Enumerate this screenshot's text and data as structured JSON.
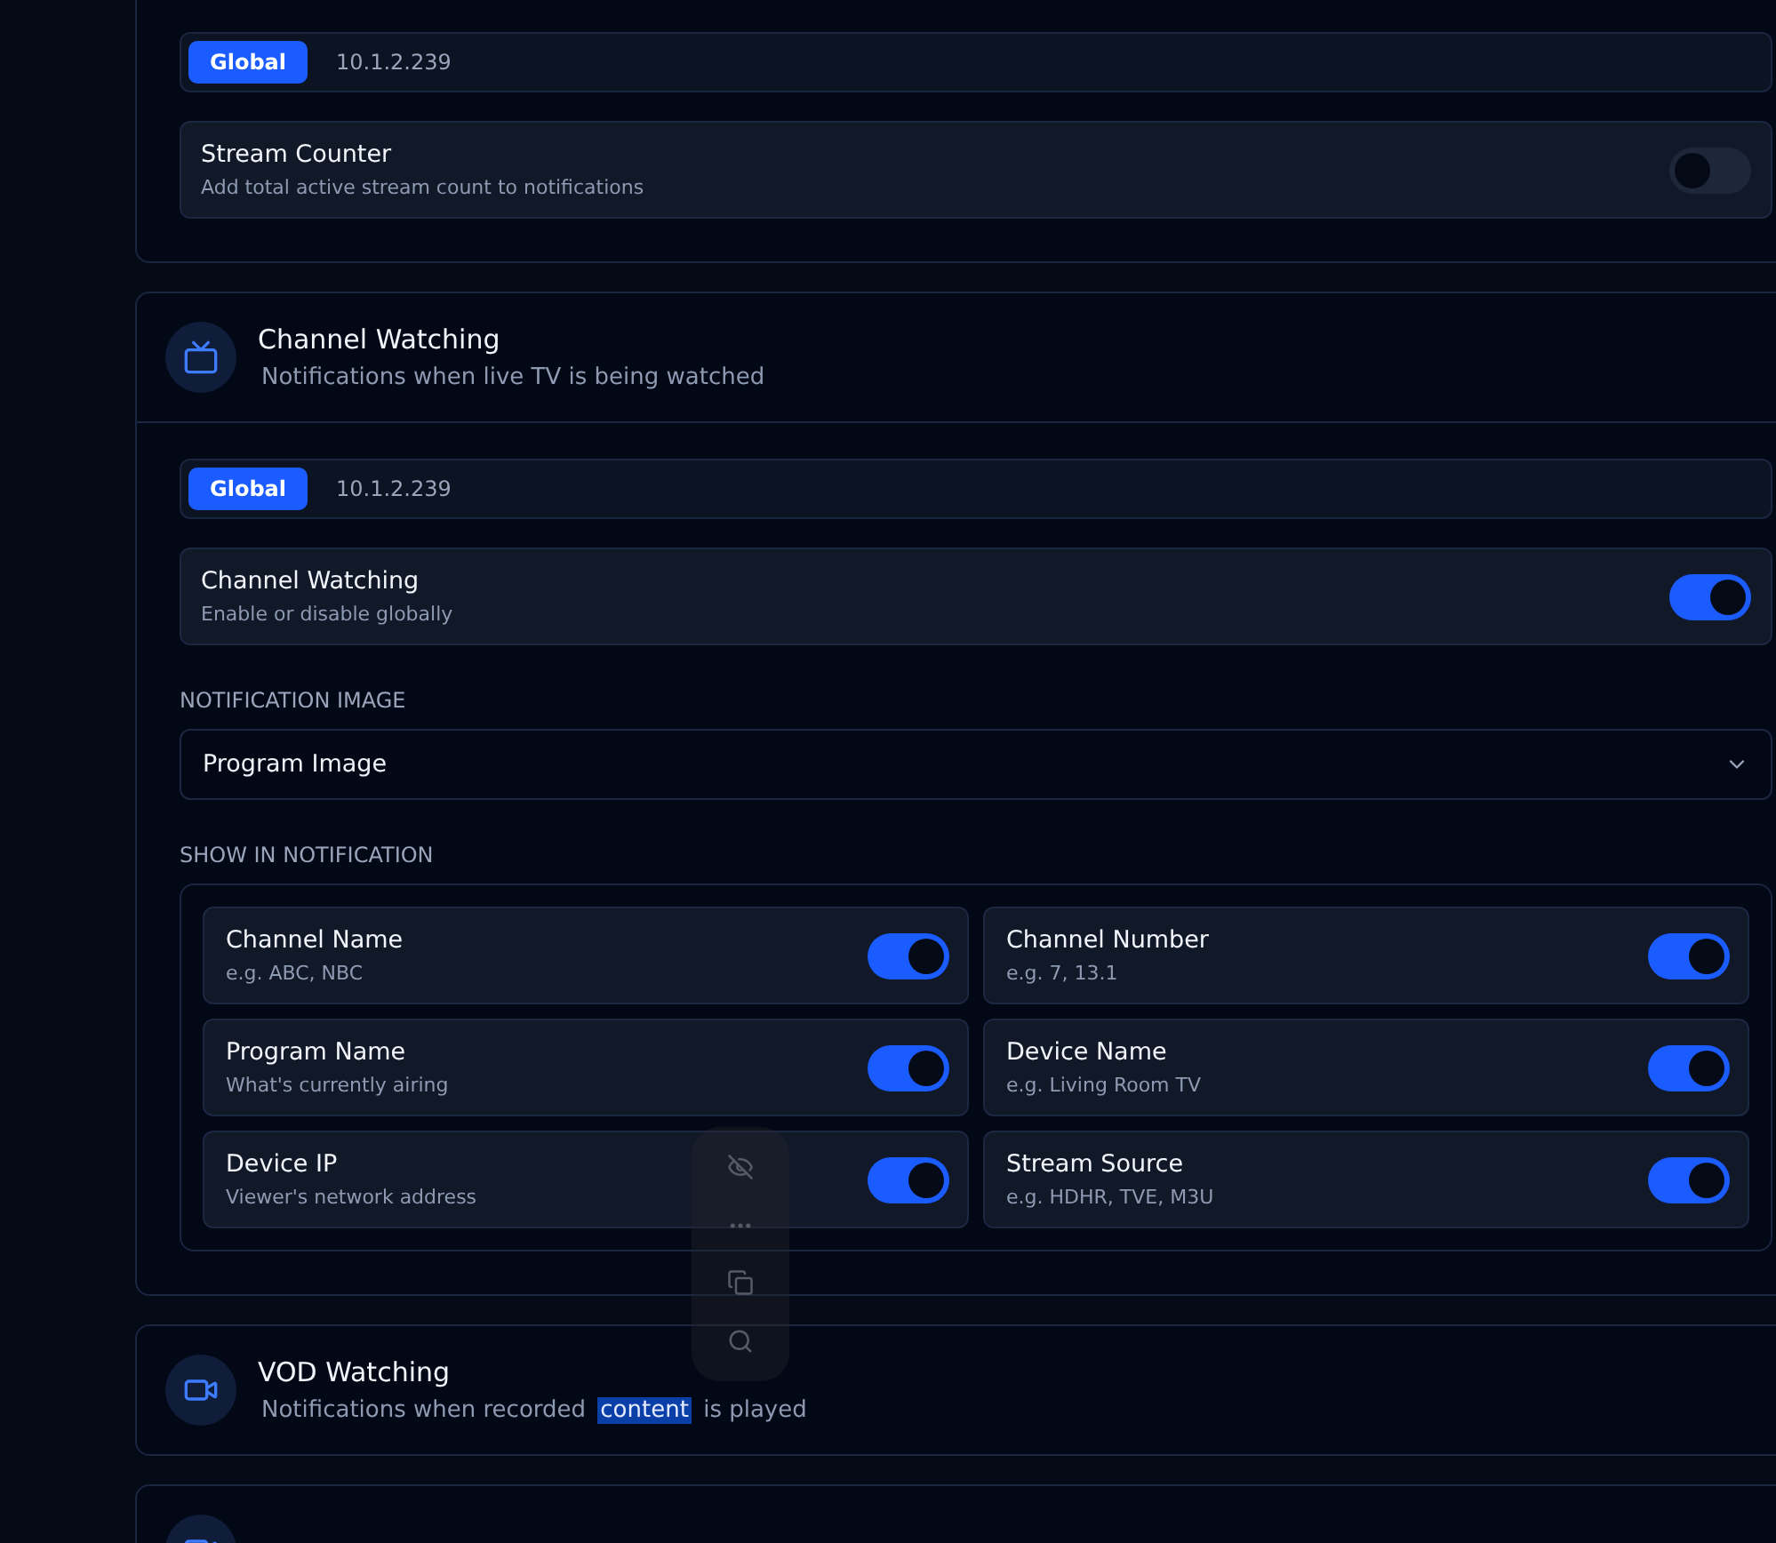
{
  "sections": [
    {
      "kind": "partial",
      "scope": {
        "badge": "Global",
        "ip": "10.1.2.239"
      },
      "setting": {
        "title": "Stream Counter",
        "description": "Add total active stream count to notifications",
        "on": false
      }
    },
    {
      "kind": "expanded",
      "title": "Channel Watching",
      "subtitle": [
        {
          "text": "Notifications when live TV is being watched",
          "selected": false
        }
      ],
      "scope": {
        "badge": "Global",
        "ip": "10.1.2.239"
      },
      "setting": {
        "title": "Channel Watching",
        "description": "Enable or disable globally",
        "on": true
      },
      "image_label": "NOTIFICATION IMAGE",
      "image_value": "Program Image",
      "show_label": "SHOW IN NOTIFICATION",
      "fields": [
        {
          "title": "Channel Name",
          "description": "e.g. ABC, NBC",
          "on": true
        },
        {
          "title": "Channel Number",
          "description": "e.g. 7, 13.1",
          "on": true
        },
        {
          "title": "Program Name",
          "description": "What's currently airing",
          "on": true
        },
        {
          "title": "Device Name",
          "description": "e.g. Living Room TV",
          "on": true
        },
        {
          "title": "Device IP",
          "description": "Viewer's network address",
          "on": true
        },
        {
          "title": "Stream Source",
          "description": "e.g. HDHR, TVE, M3U",
          "on": true
        }
      ]
    },
    {
      "kind": "collapsed",
      "title": "VOD Watching",
      "subtitle": [
        {
          "text": "Notifications when recorded",
          "selected": false
        },
        {
          "text": "content",
          "selected": true
        },
        {
          "text": "is played",
          "selected": false
        }
      ]
    },
    {
      "kind": "cut"
    }
  ]
}
